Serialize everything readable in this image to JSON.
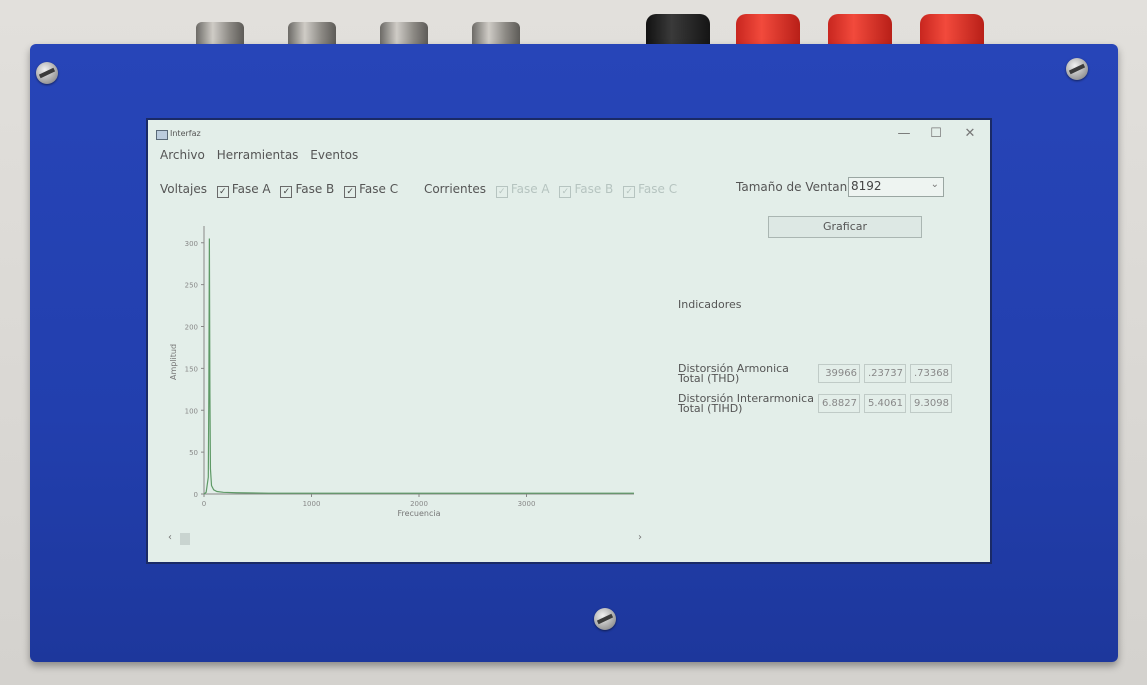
{
  "window": {
    "title": "Interfaz",
    "minimize": "—",
    "maximize": "☐",
    "close": "✕"
  },
  "menu": [
    "Archivo",
    "Herramientas",
    "Eventos"
  ],
  "voltajes": {
    "label": "Voltajes",
    "items": [
      {
        "label": "Fase A",
        "checked": true
      },
      {
        "label": "Fase B",
        "checked": true
      },
      {
        "label": "Fase C",
        "checked": true
      }
    ]
  },
  "corrientes": {
    "label": "Corrientes",
    "items": [
      {
        "label": "Fase A",
        "checked": true,
        "enabled": false
      },
      {
        "label": "Fase B",
        "checked": true,
        "enabled": false
      },
      {
        "label": "Fase C",
        "checked": true,
        "enabled": false
      }
    ]
  },
  "ventana": {
    "label": "Tamaño de Ventana",
    "value": "8192"
  },
  "graficar_label": "Graficar",
  "indicadores": {
    "title": "Indicadores",
    "thd": {
      "label": "Distorsión Armonica Total (THD)",
      "values": [
        "39966",
        ".23737",
        ".73368"
      ]
    },
    "tihd": {
      "label": "Distorsión Interarmonica Total (TIHD)",
      "values": [
        "6.8827",
        "5.4061",
        "9.3098"
      ]
    }
  },
  "chart_data": {
    "type": "line",
    "xlabel": "Frecuencia",
    "ylabel": "Amplitud",
    "xlim": [
      0,
      4000
    ],
    "ylim": [
      0,
      320
    ],
    "xticks": [
      "0",
      "1000",
      "2000",
      "3000"
    ],
    "yticks": [
      "0",
      "50",
      "100",
      "150",
      "200",
      "250",
      "300"
    ],
    "series": [
      {
        "color": "#5e9a66",
        "x": [
          0,
          20,
          40,
          45,
          50,
          55,
          60,
          70,
          90,
          120,
          180,
          300,
          600,
          1000,
          2000,
          3000,
          4000
        ],
        "y": [
          0,
          2,
          20,
          120,
          305,
          120,
          30,
          10,
          5,
          3,
          2,
          1.5,
          1,
          1,
          1,
          1,
          1
        ]
      }
    ]
  },
  "scroll": {
    "left": "‹",
    "right": "›"
  }
}
